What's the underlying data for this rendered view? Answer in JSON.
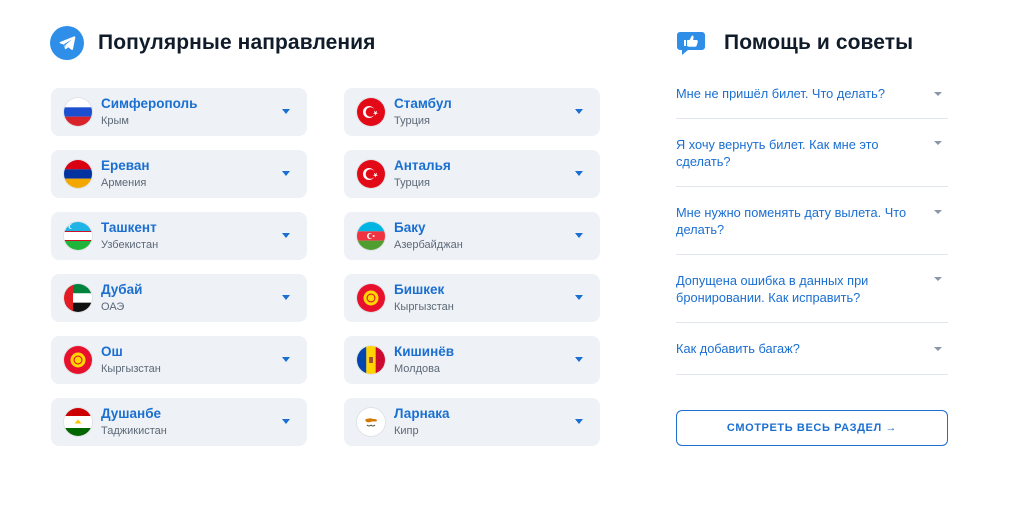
{
  "popular": {
    "title": "Популярные направления",
    "icon": "telegram-plane-icon",
    "left": [
      {
        "city": "Симферополь",
        "country": "Крым",
        "flag": "russia-flag-icon"
      },
      {
        "city": "Ереван",
        "country": "Армения",
        "flag": "armenia-flag-icon"
      },
      {
        "city": "Ташкент",
        "country": "Узбекистан",
        "flag": "uzbekistan-flag-icon"
      },
      {
        "city": "Дубай",
        "country": "ОАЭ",
        "flag": "uae-flag-icon"
      },
      {
        "city": "Ош",
        "country": "Кыргызстан",
        "flag": "kyrgyzstan-flag-icon"
      },
      {
        "city": "Душанбе",
        "country": "Таджикистан",
        "flag": "tajikistan-flag-icon"
      }
    ],
    "right": [
      {
        "city": "Стамбул",
        "country": "Турция",
        "flag": "turkey-flag-icon"
      },
      {
        "city": "Анталья",
        "country": "Турция",
        "flag": "turkey-flag-icon"
      },
      {
        "city": "Баку",
        "country": "Азербайджан",
        "flag": "azerbaijan-flag-icon"
      },
      {
        "city": "Бишкек",
        "country": "Кыргызстан",
        "flag": "kyrgyzstan-flag-icon"
      },
      {
        "city": "Кишинёв",
        "country": "Молдова",
        "flag": "moldova-flag-icon"
      },
      {
        "city": "Ларнака",
        "country": "Кипр",
        "flag": "cyprus-flag-icon"
      }
    ]
  },
  "help": {
    "title": "Помощь и советы",
    "icon": "thumbs-up-chat-icon",
    "faq": [
      {
        "question": "Мне не пришёл билет. Что делать?"
      },
      {
        "question": "Я хочу вернуть билет. Как мне это сделать?"
      },
      {
        "question": "Мне нужно поменять дату вылета. Что делать?"
      },
      {
        "question": "Допущена ошибка в данных при бронировании. Как исправить?"
      },
      {
        "question": "Как добавить багаж?"
      }
    ],
    "see_all_label": "СМОТРЕТЬ ВЕСЬ РАЗДЕЛ →"
  },
  "colors": {
    "accent": "#1a6fd1",
    "card_bg": "#eef1f5",
    "icon_bg": "#2f8fe8"
  }
}
